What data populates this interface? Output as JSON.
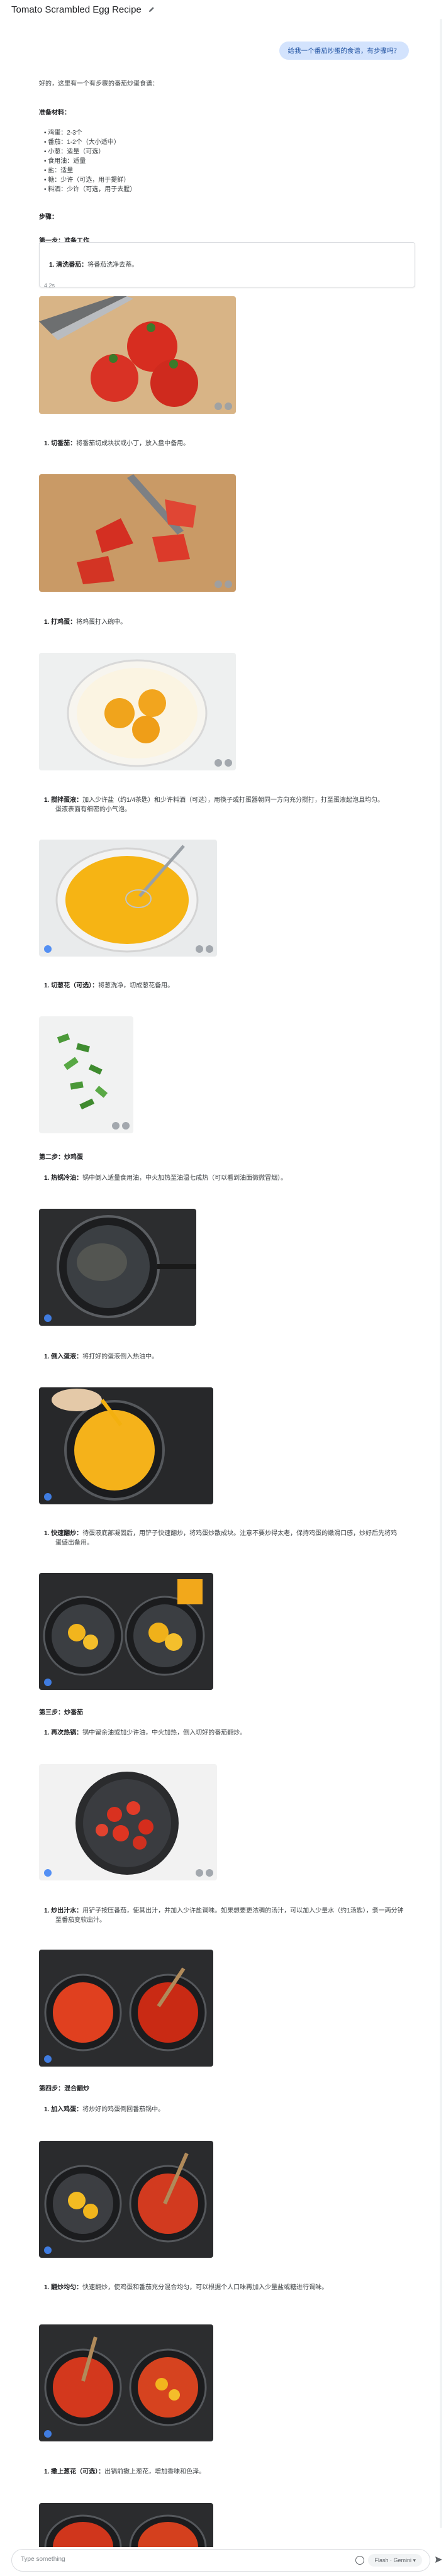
{
  "header": {
    "title": "Tomato Scrambled Egg Recipe"
  },
  "user_message": "给我一个番茄炒蛋的食谱，有步骤吗？",
  "reply": {
    "intro": "好的，这里有一个有步骤的番茄炒蛋食谱：",
    "ingredients_title": "准备材料：",
    "ingredients": [
      "• 鸡蛋：2-3个",
      "• 番茄：1-2个（大小适中）",
      "• 小葱：适量（可选）",
      "• 食用油：适量",
      "• 盐：适量",
      "• 糖：少许（可选，用于提鲜）",
      "• 料酒：少许（可选，用于去腥）"
    ],
    "steps_title": "步骤：",
    "stage1": "第一步：准备工作",
    "s1_1_label": "1. 清洗番茄：",
    "s1_1_text": "将番茄洗净去蒂。",
    "cursor_text": "4.2s",
    "s1_2_label": "1. 切番茄：",
    "s1_2_text": "将番茄切成块状或小丁，放入盘中备用。",
    "s1_3_label": "1. 打鸡蛋：",
    "s1_3_text": "将鸡蛋打入碗中。",
    "s1_4_label": "1. 搅拌蛋液：",
    "s1_4_text": "加入少许盐（约1/4茶匙）和少许料酒（可选），用筷子或打蛋器朝同一方向充分搅打，打至蛋液起泡且均匀。",
    "s1_4_text2": "蛋液表面有细密的小气泡。",
    "s1_5_label": "1. 切葱花（可选）：",
    "s1_5_text": "将葱洗净，切成葱花备用。",
    "stage2": "第二步：炒鸡蛋",
    "s2_1_label": "1. 热锅冷油：",
    "s2_1_text": "锅中倒入适量食用油，中火加热至油温七成热（可以看到油面微微冒烟）。",
    "s2_2_label": "1. 倒入蛋液：",
    "s2_2_text": "将打好的蛋液倒入热油中。",
    "s2_3_label": "1. 快速翻炒：",
    "s2_3_text": "待蛋液底部凝固后，用铲子快速翻炒，将鸡蛋炒散成块。注意不要炒得太老，保持鸡蛋的嫩滑口感，炒好后先将鸡",
    "s2_3_text2": "蛋盛出备用。",
    "stage3": "第三步：炒番茄",
    "s3_1_label": "1. 再次热锅：",
    "s3_1_text": "锅中留余油或加少许油，中火加热，倒入切好的番茄翻炒。",
    "s3_2_label": "1. 炒出汁水：",
    "s3_2_text": "用铲子按压番茄，使其出汁，并加入少许盐调味。如果想要更浓稠的汤汁，可以加入少量水（约1汤匙），煮一两分钟",
    "s3_2_text2": "至番茄变软出汁。",
    "stage4": "第四步：混合翻炒",
    "s4_1_label": "1. 加入鸡蛋：",
    "s4_1_text": "将炒好的鸡蛋倒回番茄锅中。",
    "s4_2_label": "1. 翻炒均匀：",
    "s4_2_text": "快速翻炒，使鸡蛋和番茄充分混合均匀，可以根据个人口味再加入少量盐或糖进行调味。",
    "s4_3_label": "1. 撒上葱花（可选）：",
    "s4_3_text": "出锅前撒上葱花，增加香味和色泽。"
  },
  "input": {
    "placeholder": "Type something",
    "model": "Flash · Gemini ▾"
  },
  "icons": {
    "edit": "pencil-icon",
    "add": "plus-icon",
    "send": "send-icon",
    "image_action": "image-action-icon"
  },
  "colors": {
    "user_bubble": "#d3e3fd",
    "accent": "#1a73e8"
  }
}
